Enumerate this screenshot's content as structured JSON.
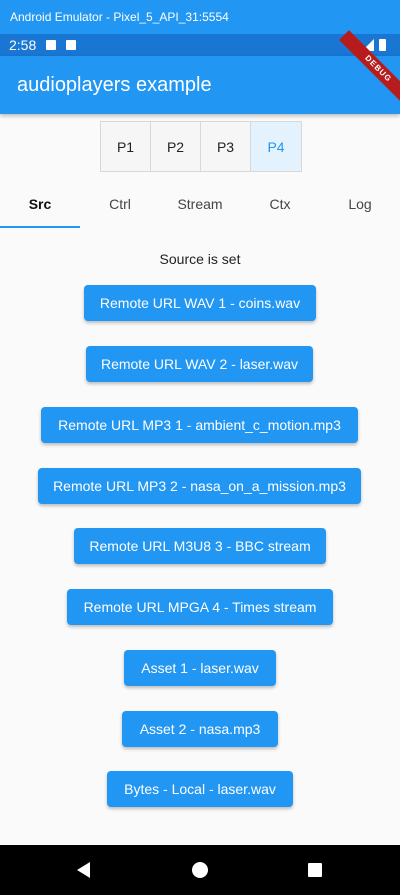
{
  "window": {
    "title": "Android Emulator - Pixel_5_API_31:5554"
  },
  "status_bar": {
    "time": "2:58"
  },
  "app_bar": {
    "title": "audioplayers example",
    "debug_label": "DEBUG"
  },
  "players": {
    "tabs": [
      "P1",
      "P2",
      "P3",
      "P4"
    ],
    "selected": "P4",
    "accent_color": "#2196f3"
  },
  "main_tabs": {
    "items": [
      "Src",
      "Ctrl",
      "Stream",
      "Ctx",
      "Log"
    ],
    "selected": "Src"
  },
  "source": {
    "status": "Source is set",
    "buttons": [
      "Remote URL WAV 1 - coins.wav",
      "Remote URL WAV 2 - laser.wav",
      "Remote URL MP3 1 - ambient_c_motion.mp3",
      "Remote URL MP3 2 - nasa_on_a_mission.mp3",
      "Remote URL M3U8 3 - BBC stream",
      "Remote URL MPGA 4 - Times stream",
      "Asset 1 - laser.wav",
      "Asset 2 - nasa.mp3",
      "Bytes - Local - laser.wav"
    ]
  },
  "nav_bar": {
    "icons": [
      "back-icon",
      "home-icon",
      "recents-icon"
    ]
  }
}
